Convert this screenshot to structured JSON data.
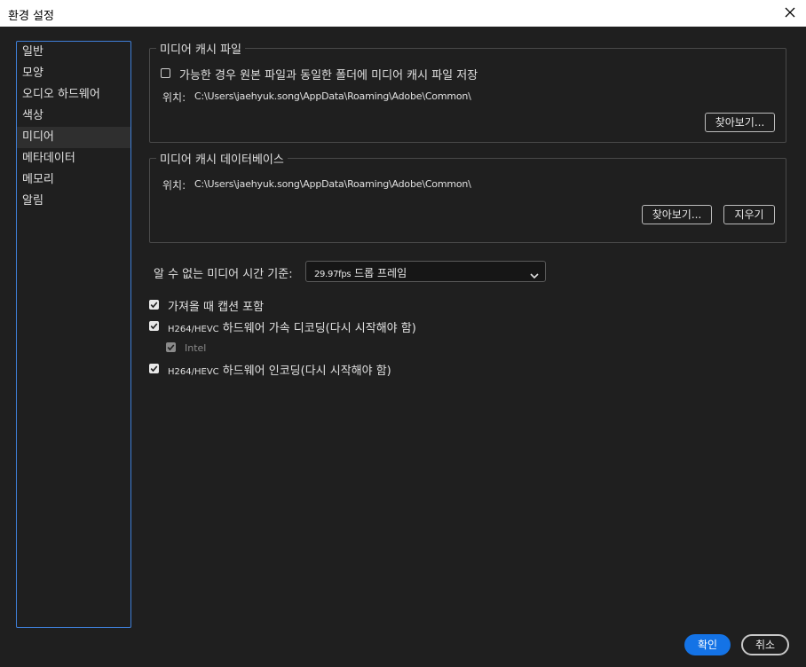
{
  "window": {
    "title": "환경 설정"
  },
  "sidebar": {
    "items": [
      {
        "label": "일반"
      },
      {
        "label": "모양"
      },
      {
        "label": "오디오 하드웨어"
      },
      {
        "label": "색상"
      },
      {
        "label": "미디어",
        "selected": true
      },
      {
        "label": "메타데이터"
      },
      {
        "label": "메모리"
      },
      {
        "label": "알림"
      }
    ]
  },
  "media_cache_files": {
    "title": "미디어 캐시 파일",
    "save_next_to_originals": {
      "label": "가능한 경우 원본 파일과 동일한 폴더에 미디어 캐시 파일 저장",
      "checked": false
    },
    "location_label": "위치:",
    "location_path": "C:\\Users\\jaehyuk.song\\AppData\\Roaming\\Adobe\\Common\\",
    "browse_label": "찾아보기..."
  },
  "media_cache_database": {
    "title": "미디어 캐시 데이터베이스",
    "location_label": "위치:",
    "location_path": "C:\\Users\\jaehyuk.song\\AppData\\Roaming\\Adobe\\Common\\",
    "browse_label": "찾아보기...",
    "clear_label": "지우기"
  },
  "timecode": {
    "label": "알 수 없는 미디어 시간 기준:",
    "value_fps": "29.97fps",
    "value_rest": " 드롭 프레임"
  },
  "options": {
    "include_captions": {
      "label": "가져올 때 캡션 포함",
      "checked": true
    },
    "hw_decoding": {
      "prefix": "H264/HEVC",
      "label": " 하드웨어 가속 디코딩(다시 시작해야 함)",
      "checked": true
    },
    "intel": {
      "label": "Intel",
      "checked": true,
      "disabled": true
    },
    "hw_encoding": {
      "prefix": "H264/HEVC",
      "label": " 하드웨어 인코딩(다시 시작해야 함)",
      "checked": true
    }
  },
  "footer": {
    "ok_label": "확인",
    "cancel_label": "취소"
  },
  "colors": {
    "accent": "#1473e6",
    "sidebar_border": "#3f7fd8",
    "background": "#1f1f1f"
  }
}
